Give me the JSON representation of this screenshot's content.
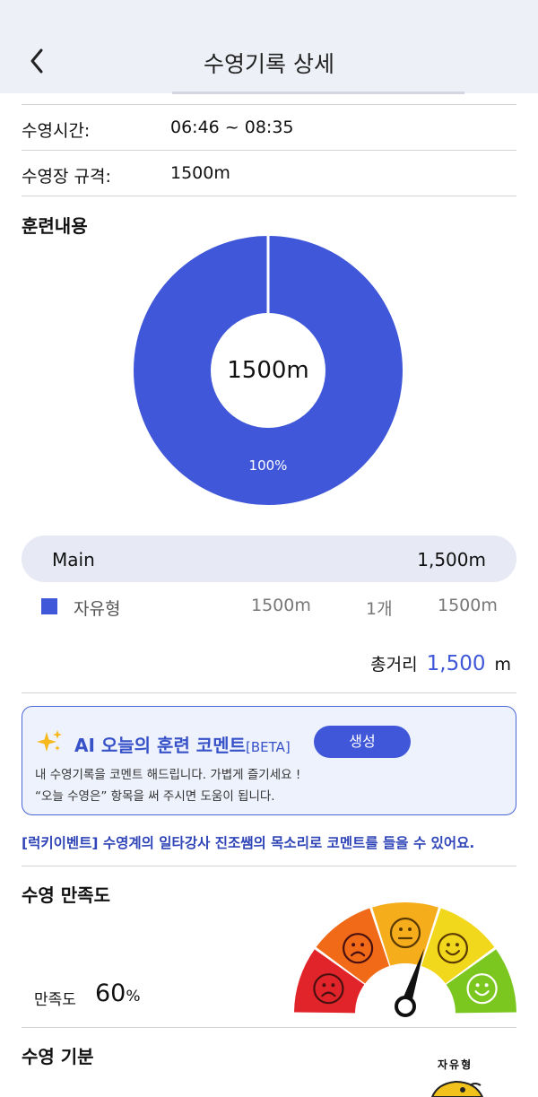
{
  "header": {
    "title": "수영기록 상세"
  },
  "info": {
    "time_label": "수영시간:",
    "time_value": "06:46 ~ 08:35",
    "pool_label": "수영장 규격:",
    "pool_value": "1500m"
  },
  "training": {
    "title": "훈련내용",
    "center_label": "1500m",
    "percent_label": "100%",
    "main_name": "Main",
    "main_distance": "1,500m",
    "stroke_name": "자유형",
    "stroke_distance": "1500m",
    "stroke_count": "1개",
    "stroke_total": "1500m",
    "total_label": "총거리",
    "total_value": "1,500",
    "total_unit": "m"
  },
  "chart_data": {
    "type": "pie",
    "categories": [
      "자유형"
    ],
    "values": [
      100
    ],
    "center_text": "1500m",
    "colors": [
      "#3f57d8"
    ]
  },
  "ai_comment": {
    "title": "AI 오늘의 훈련 코멘트",
    "beta": "[BETA]",
    "button_label": "생성",
    "desc_line1": "내 수영기록을 코멘트 해드립니다. 가볍게 즐기세요 !",
    "desc_line2": "“오늘 수영은” 항목을 써 주시면 도움이 됩니다."
  },
  "event_text": "[럭키이벤트] 수영계의 일타강사 진조쌤의 목소리로 코멘트를 들을 수 있어요.",
  "satisfaction": {
    "title": "수영 만족도",
    "label": "만족도",
    "value": "60",
    "unit": "%",
    "level": 0.6
  },
  "mood": {
    "title": "수영 기분",
    "tag": "자유형"
  },
  "colors": {
    "accent": "#3f57d8",
    "gauge": [
      "#e0242a",
      "#f06a18",
      "#f5ad1c",
      "#f2d81c",
      "#7bc720"
    ]
  },
  "icons": {
    "back": "chevron-left-icon",
    "sparkle": "sparkle-icon"
  }
}
